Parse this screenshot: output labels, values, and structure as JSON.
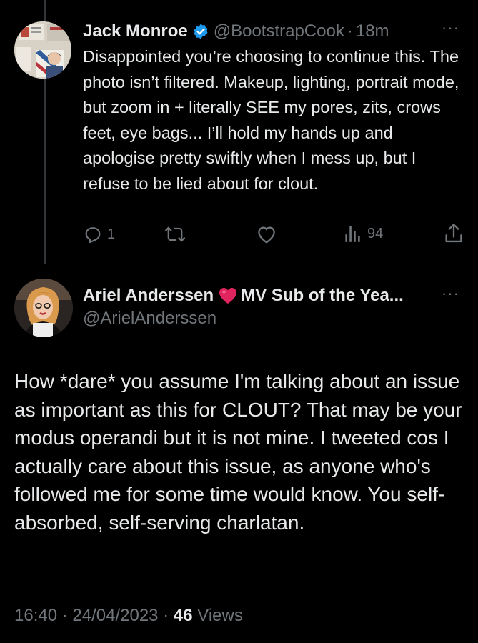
{
  "tweet1": {
    "author_name": "Jack Monroe",
    "handle": "@BootstrapCook",
    "separator": "·",
    "time": "18m",
    "more": "···",
    "avatar_text": "Jack Monroe",
    "body": "Disappointed you’re choosing to continue this. The photo isn’t filtered. Makeup, lighting, portrait mode, but zoom in + literally SEE my pores, zits, crows feet, eye bags... I’ll hold my hands up and apologise pretty swiftly when I mess up, but I refuse to be lied about for clout.",
    "reply_count": "1",
    "views_count": "94",
    "verified_color": "#1d9bf0"
  },
  "tweet2": {
    "author_name_pre": "Ariel Anderssen",
    "author_name_post": "MV Sub of the Yea...",
    "handle": "@ArielAnderssen",
    "more": "···",
    "body": "How *dare* you assume I'm talking about an issue as important as this for CLOUT? That may be your modus operandi but it is not mine. I tweeted cos I actually care about this issue, as anyone who's followed me for some time would know. You self-absorbed, self-serving charlatan.",
    "time": "16:40",
    "separator": "·",
    "date": "24/04/2023",
    "views_count": "46",
    "views_label": "Views",
    "heart_color": "#e0245e"
  }
}
